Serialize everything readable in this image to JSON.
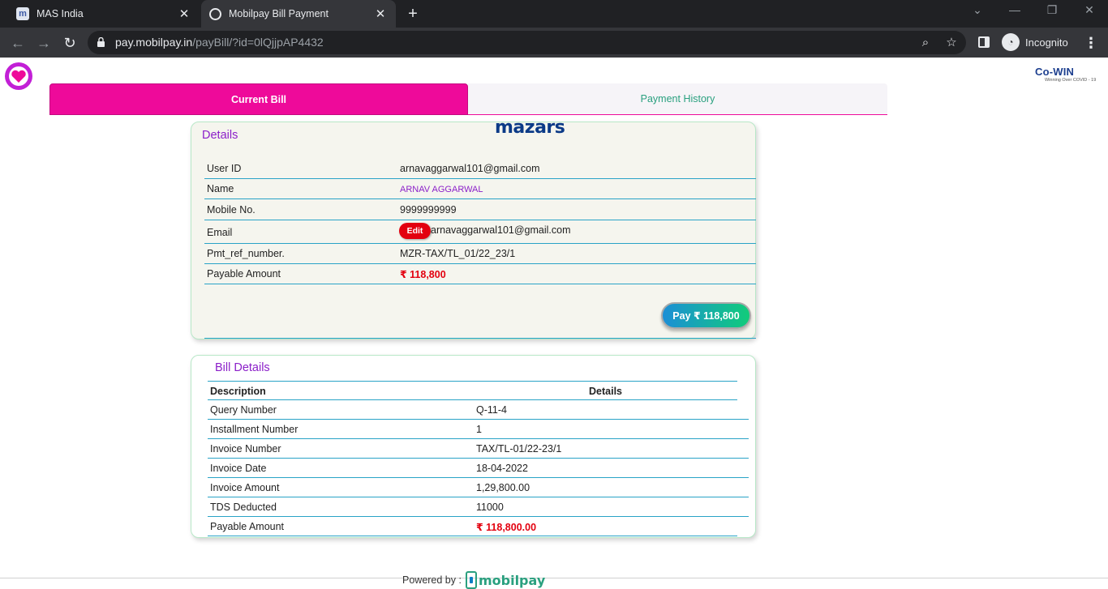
{
  "browser": {
    "tabs": [
      {
        "title": "MAS India",
        "favicon": "m-logo-icon",
        "active": false
      },
      {
        "title": "Mobilpay Bill Payment",
        "favicon": "globe-icon",
        "active": true
      }
    ],
    "url_host": "pay.mobilpay.in",
    "url_path": "/payBill/?id=0lQjjpAP4432",
    "incognito_label": "Incognito"
  },
  "page": {
    "tabs": {
      "current": "Current Bill",
      "history": "Payment History"
    },
    "details_card": {
      "title": "Details",
      "brand": "mazars",
      "rows": [
        {
          "label": "User ID",
          "value": "arnavaggarwal101@gmail.com"
        },
        {
          "label": "Name",
          "value": "ARNAV AGGARWAL"
        },
        {
          "label": "Mobile No.",
          "value": "9999999999"
        },
        {
          "label": "Email",
          "value": "arnavaggarwal101@gmail.com",
          "edit_label": "Edit"
        },
        {
          "label": "Pmt_ref_number.",
          "value": "MZR-TAX/TL_01/22_23/1"
        },
        {
          "label": "Payable Amount",
          "value": "₹ 118,800"
        }
      ],
      "pay_button": "Pay ₹ 118,800"
    },
    "bill_card": {
      "title": "Bill Details",
      "header": {
        "description": "Description",
        "details": "Details"
      },
      "rows": [
        {
          "label": "Query Number",
          "value": "Q-11-4"
        },
        {
          "label": "Installment Number",
          "value": "1"
        },
        {
          "label": "Invoice Number",
          "value": "TAX/TL-01/22-23/1"
        },
        {
          "label": "Invoice Date",
          "value": "18-04-2022"
        },
        {
          "label": "Invoice Amount",
          "value": "1,29,800.00"
        },
        {
          "label": "TDS Deducted",
          "value": "11000"
        },
        {
          "label": "Payable Amount",
          "value": "₹ 118,800.00"
        }
      ]
    },
    "cowin": {
      "logo_text": "Co-WIN",
      "tagline": "Winning Over COVID - 19"
    },
    "footer": {
      "powered_by": "Powered by :",
      "brand": "mobilpay"
    }
  },
  "colors": {
    "accent_pink": "#ee0a9a",
    "title_purple": "#8b1fc9",
    "amount_red": "#e3000f",
    "row_border": "#29a3c7",
    "history_green": "#2aa07f"
  }
}
